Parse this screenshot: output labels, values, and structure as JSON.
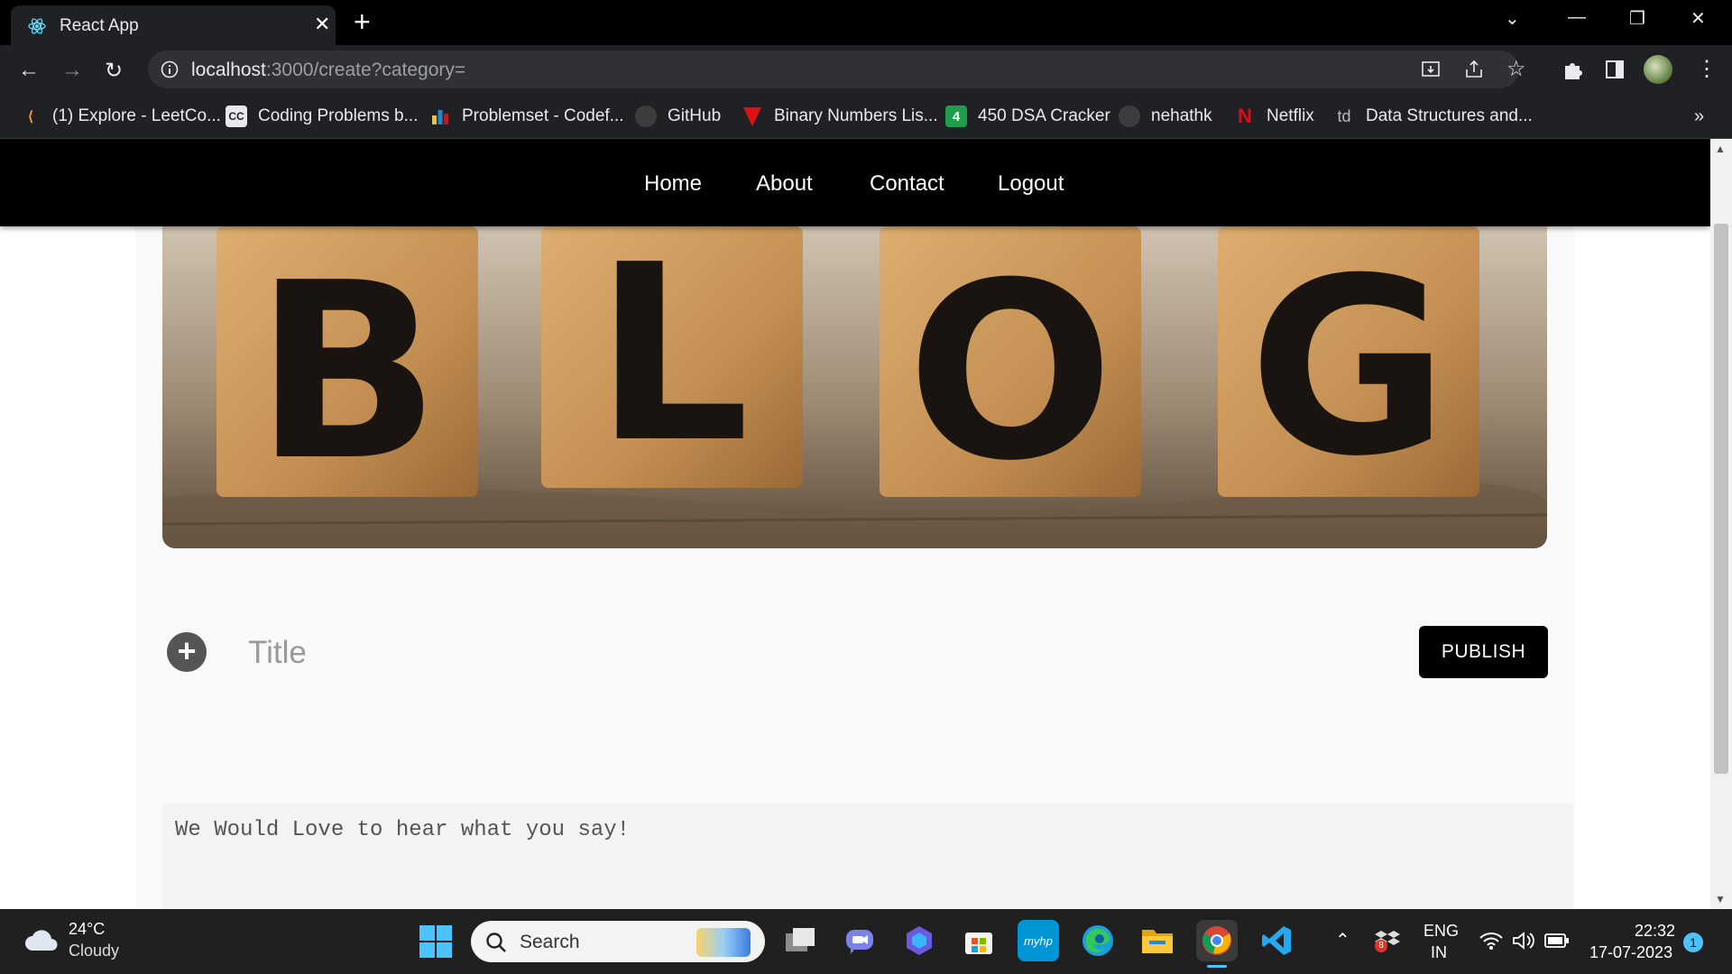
{
  "browser": {
    "tab_title": "React App",
    "url_host": "localhost",
    "url_rest": ":3000/create?category=",
    "bookmarks": [
      {
        "label": "(1) Explore - LeetCo...",
        "icon": "leetcode-icon"
      },
      {
        "label": "Coding Problems b...",
        "icon": "codingninjas-icon"
      },
      {
        "label": "Problemset - Codef...",
        "icon": "codeforces-icon"
      },
      {
        "label": "GitHub",
        "icon": "github-icon"
      },
      {
        "label": "Binary Numbers Lis...",
        "icon": "hackerrank-icon"
      },
      {
        "label": "450 DSA Cracker",
        "icon": "dsa-cracker-icon"
      },
      {
        "label": "nehathk",
        "icon": "github-icon"
      },
      {
        "label": "Netflix",
        "icon": "netflix-icon"
      },
      {
        "label": "Data Structures and...",
        "icon": "td-icon"
      }
    ],
    "bookmark_td": "td",
    "dsa_badge": "4",
    "cc_badge": "CC"
  },
  "nav": {
    "home": "Home",
    "about": "About",
    "contact": "Contact",
    "logout": "Logout"
  },
  "banner": {
    "letters": [
      "B",
      "L",
      "O",
      "G"
    ]
  },
  "editor": {
    "title_placeholder": "Title",
    "publish_label": "PUBLISH",
    "body_placeholder": "We Would Love to hear what you say!"
  },
  "taskbar": {
    "weather_temp": "24°C",
    "weather_desc": "Cloudy",
    "search_label": "Search",
    "lang_1": "ENG",
    "lang_2": "IN",
    "time": "22:32",
    "date": "17-07-2023",
    "notification_count": "1",
    "tray_badge": "8"
  },
  "colors": {
    "chrome_bg": "#202124",
    "nav_bg": "#000000",
    "publish_bg": "#000000",
    "taskbar_bg": "#202020"
  }
}
